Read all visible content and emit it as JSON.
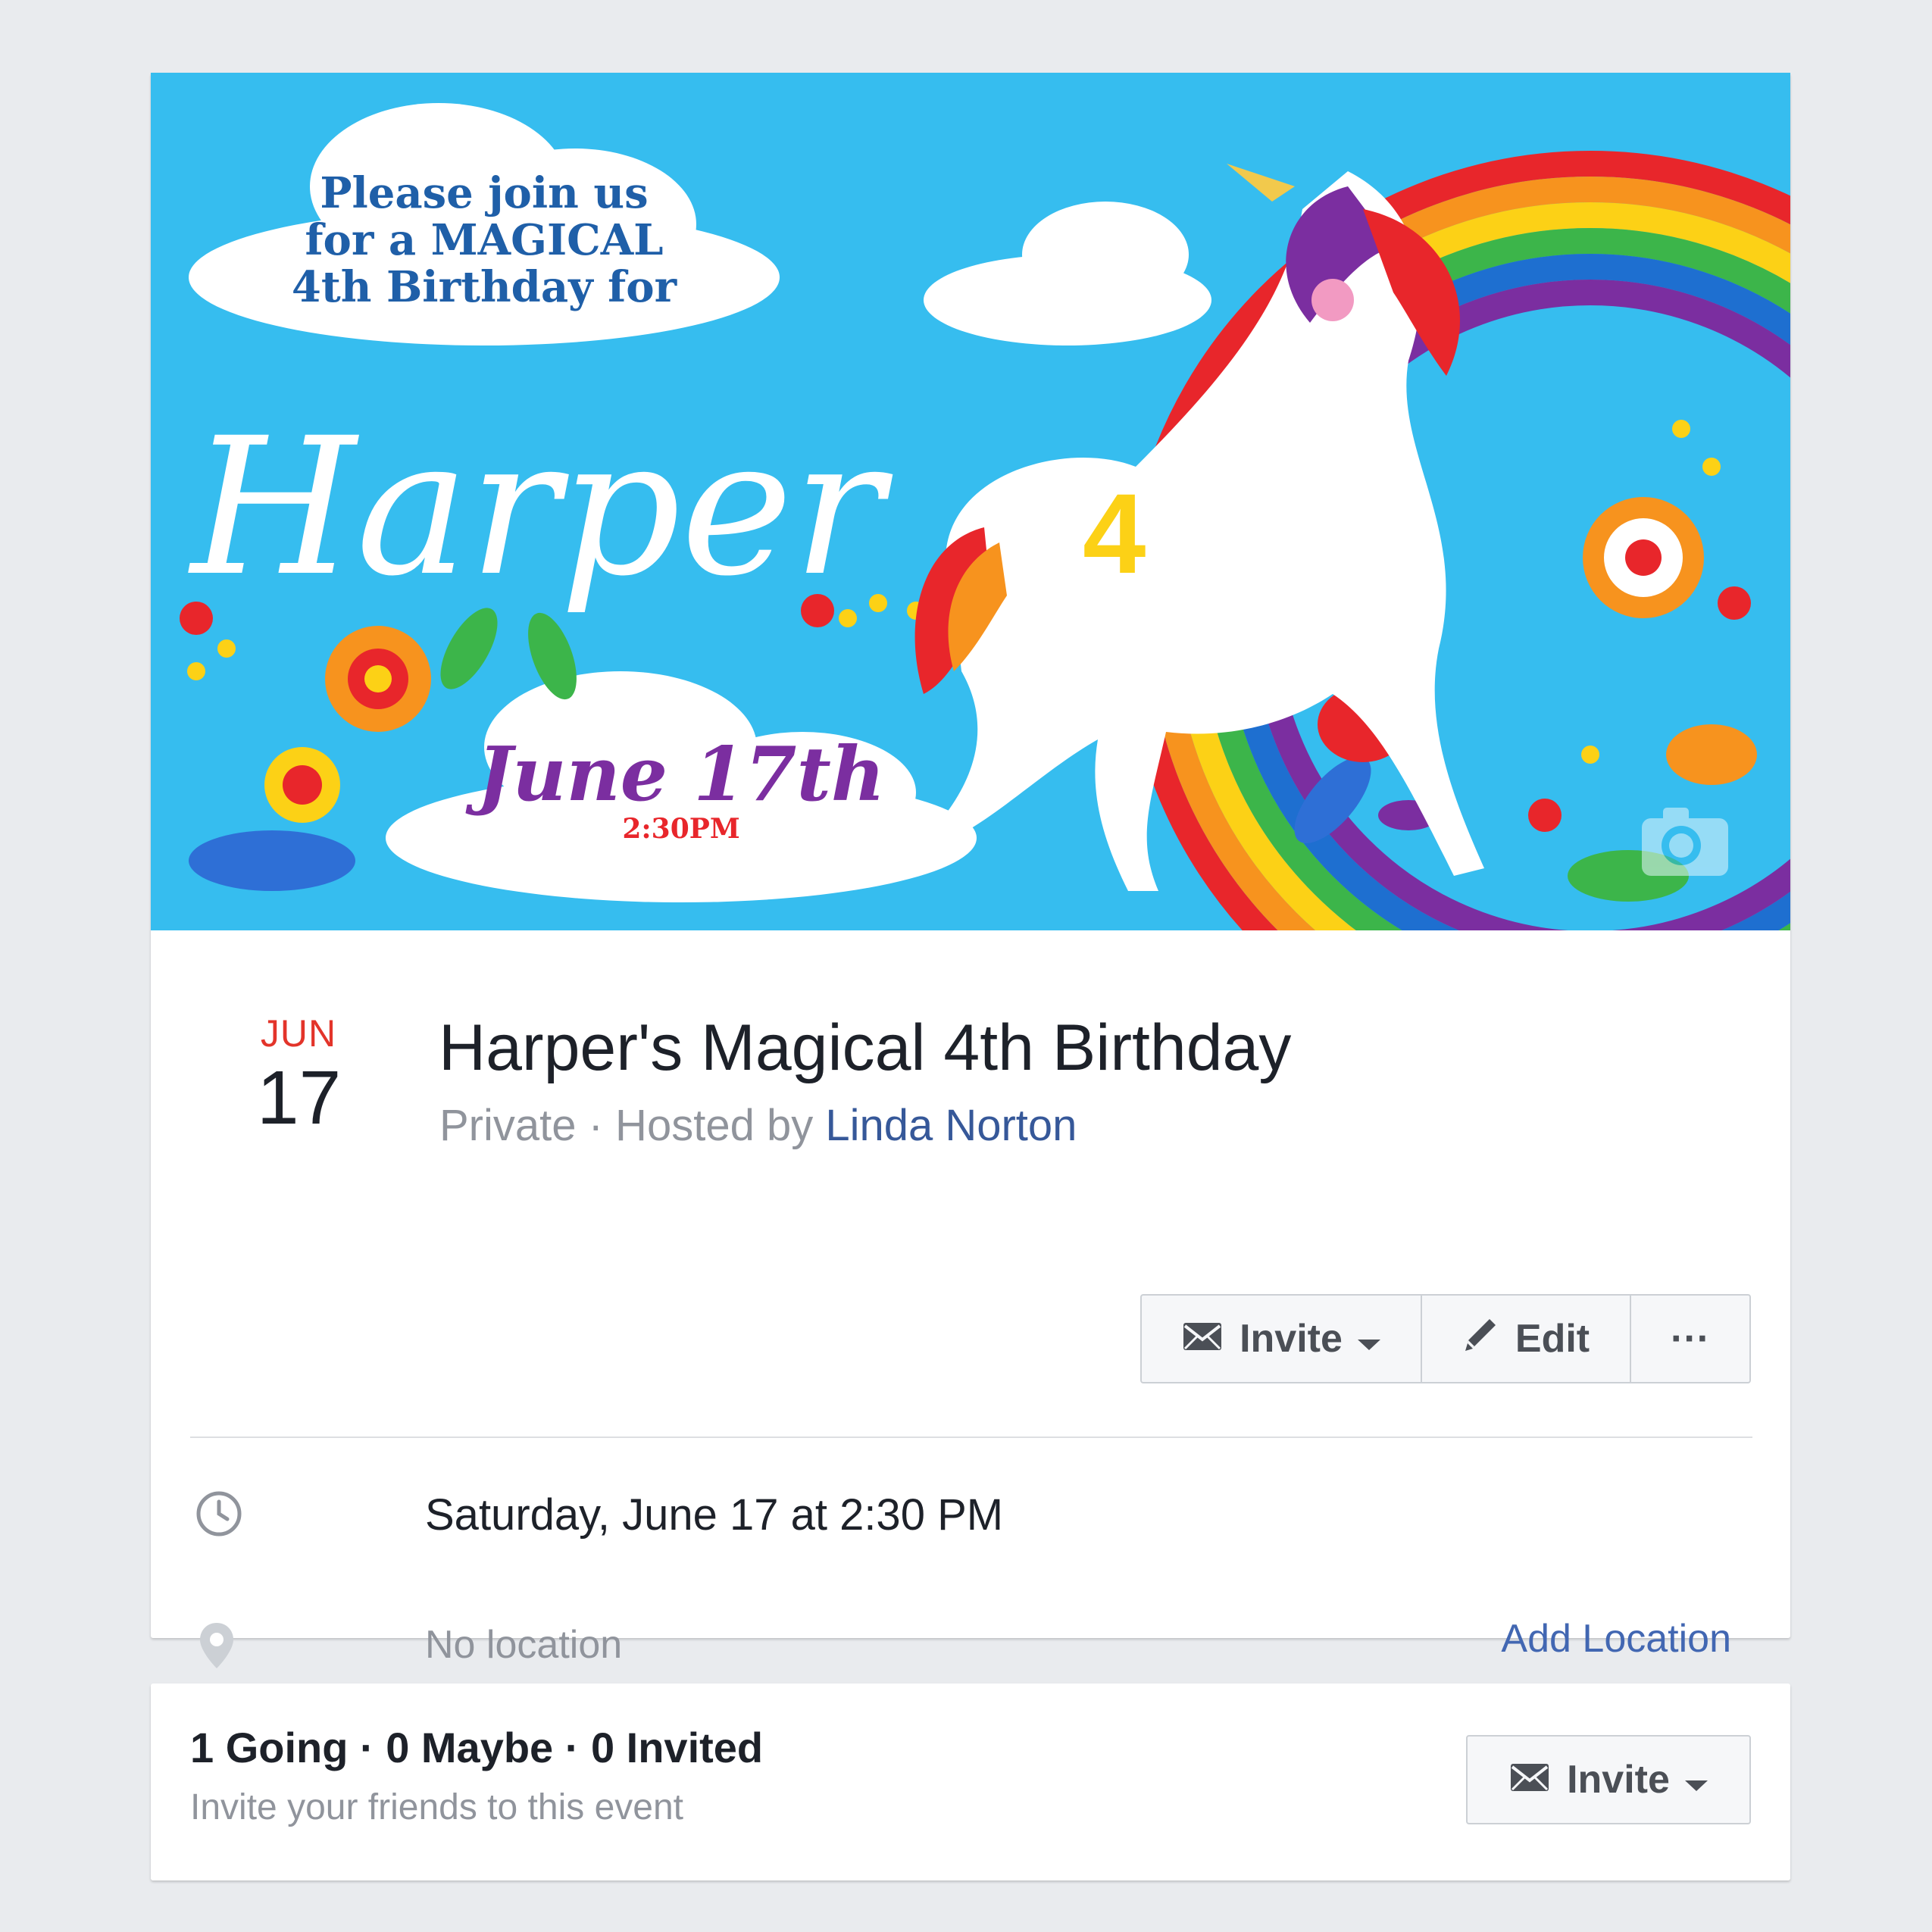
{
  "cover": {
    "invite_line_1": "Please join us",
    "invite_line_2": "for a MAGICAL",
    "invite_line_3": "4th Birthday for",
    "name": "Harper",
    "date": "June 17th",
    "time": "2:30PM",
    "age_number": "4",
    "camera_icon": "camera-icon"
  },
  "event": {
    "month": "JUN",
    "day": "17",
    "title": "Harper's Magical 4th Birthday",
    "privacy": "Private · Hosted by ",
    "host": "Linda Norton"
  },
  "actions": {
    "invite_label": "Invite",
    "edit_label": "Edit",
    "more_label": "···",
    "invite_icon": "envelope-icon",
    "edit_icon": "pencil-icon"
  },
  "details": {
    "datetime": "Saturday, June 17 at 2:30 PM",
    "location": "No location",
    "add_location": "Add Location",
    "clock_icon": "clock-icon",
    "pin_icon": "map-pin-icon"
  },
  "stats": {
    "summary": "1 Going · 0 Maybe · 0 Invited",
    "subtitle": "Invite your friends to this event",
    "invite_label": "Invite"
  },
  "colors": {
    "page_background": "#e9ebee",
    "sky": "#36bdef",
    "date_red": "#e3342a",
    "link_blue": "#365899",
    "add_link_blue": "#4267b2"
  }
}
